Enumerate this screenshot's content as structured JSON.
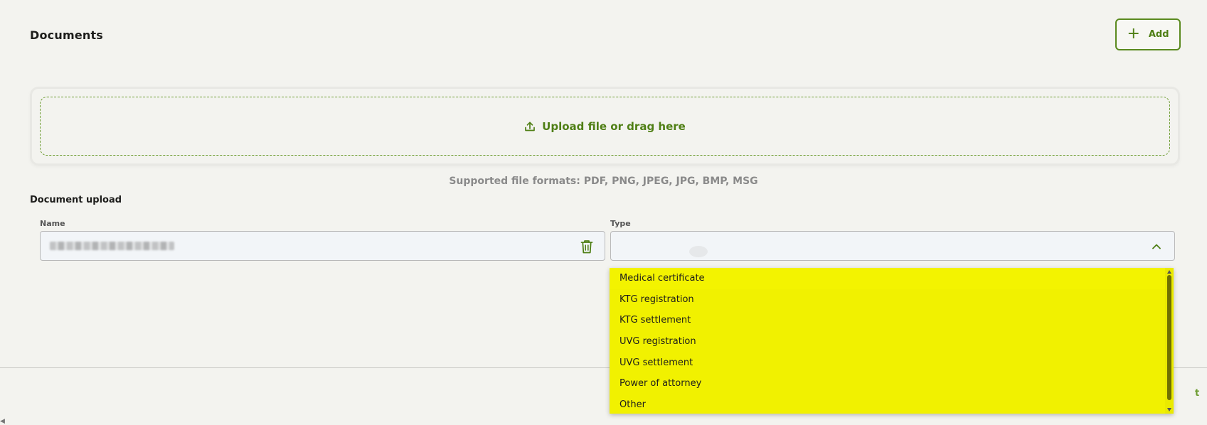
{
  "header": {
    "title": "Documents",
    "add_button": {
      "label": "Add",
      "icon": "plus-icon"
    }
  },
  "upload": {
    "dropzone_label": "Upload file or drag here",
    "icon": "upload-icon",
    "supported_formats": "Supported file formats: PDF, PNG, JPEG, JPG, BMP, MSG"
  },
  "document_upload": {
    "title": "Document upload",
    "name_label": "Name",
    "type_label": "Type",
    "delete_icon": "trash-icon",
    "toggle_icon": "chevron-up-icon"
  },
  "type_options": [
    "Medical certificate",
    "KTG registration",
    "KTG settlement",
    "UVG registration",
    "UVG settlement",
    "Power of attorney",
    "Other"
  ],
  "footer": {
    "partial_text": "t"
  },
  "colors": {
    "accent": "#4f7f15",
    "dropdown_highlight": "#f1f100",
    "background": "#f3f3ef"
  }
}
